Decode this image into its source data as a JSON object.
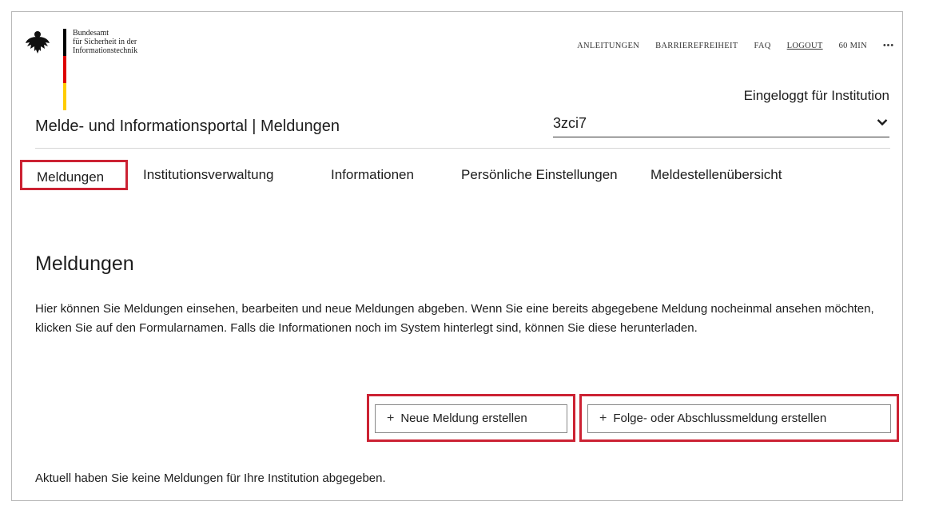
{
  "logo": {
    "line1": "Bundesamt",
    "line2": "für Sicherheit in der",
    "line3": "Informationstechnik"
  },
  "topnav": {
    "anleitungen": "ANLEITUNGEN",
    "barrierefreiheit": "BARRIEREFREIHEIT",
    "faq": "FAQ",
    "logout": "LOGOUT",
    "timer": "60 MIN",
    "more": "•••"
  },
  "header": {
    "logged_in_label": "Eingeloggt für Institution",
    "portal_title": "Melde- und Informationsportal | Meldungen",
    "institution_value": "3zci7"
  },
  "mainnav": {
    "items": [
      {
        "label": "Meldungen"
      },
      {
        "label": "Institutionsverwaltung"
      },
      {
        "label": "Informationen"
      },
      {
        "label": "Persönliche Einstellungen"
      },
      {
        "label": "Meldestellenübersicht"
      }
    ]
  },
  "main": {
    "title": "Meldungen",
    "intro": "Hier können Sie Meldungen einsehen, bearbeiten und neue Meldungen abgeben. Wenn Sie eine bereits abgegebene Meldung nocheinmal ansehen möchten, klicken Sie auf den Formularnamen. Falls die Informationen noch im System hinterlegt sind, können Sie diese herunterladen.",
    "new_button": "Neue Meldung erstellen",
    "followup_button": "Folge- oder Abschlussmeldung erstellen",
    "status": "Aktuell haben Sie keine Meldungen für Ihre Institution abgegeben."
  },
  "colors": {
    "highlight": "#cc2233",
    "flag_black": "#000000",
    "flag_red": "#dd0000",
    "flag_gold": "#ffcc00"
  }
}
